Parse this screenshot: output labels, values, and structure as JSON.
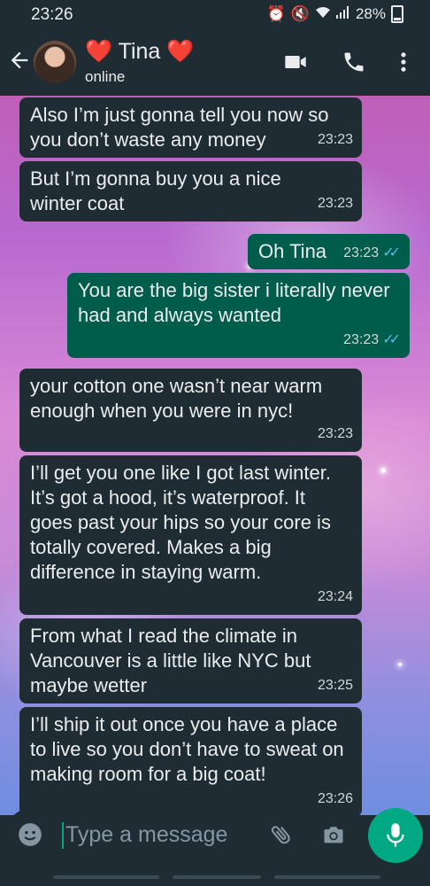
{
  "status_bar": {
    "time": "23:26",
    "battery": "28%"
  },
  "header": {
    "contact_name": "❤️ Tina ❤️",
    "contact_status": "online"
  },
  "messages": [
    {
      "direction": "in",
      "text": "Also I’m just gonna tell you now so you don’t waste any money",
      "time": "23:23"
    },
    {
      "direction": "in",
      "text": "But I’m gonna buy you a nice winter coat",
      "time": "23:23"
    },
    {
      "direction": "out",
      "text": "Oh Tina",
      "time": "23:23"
    },
    {
      "direction": "out",
      "text": "You are the big sister i literally never had and always wanted",
      "time": "23:23"
    },
    {
      "direction": "in",
      "text": "your cotton one wasn’t near warm enough when you were in nyc!",
      "time": "23:23"
    },
    {
      "direction": "in",
      "text": "I’ll get you one like I got last winter. It’s got a hood, it’s waterproof. It goes past your hips so your core is totally covered. Makes a big difference in staying warm.",
      "time": "23:24"
    },
    {
      "direction": "in",
      "text": "From what I read the climate in Vancouver is a little like NYC but maybe wetter",
      "time": "23:25"
    },
    {
      "direction": "in",
      "text": "I’ll ship it out once you have a place to live so you don’t have to sweat on making room for a big coat!",
      "time": "23:26"
    }
  ],
  "composer": {
    "placeholder": "Type a message"
  },
  "colors": {
    "incoming_bubble": "#1f2c34",
    "outgoing_bubble": "#005c4b",
    "accent": "#00a884",
    "read_ticks": "#53bdeb"
  }
}
